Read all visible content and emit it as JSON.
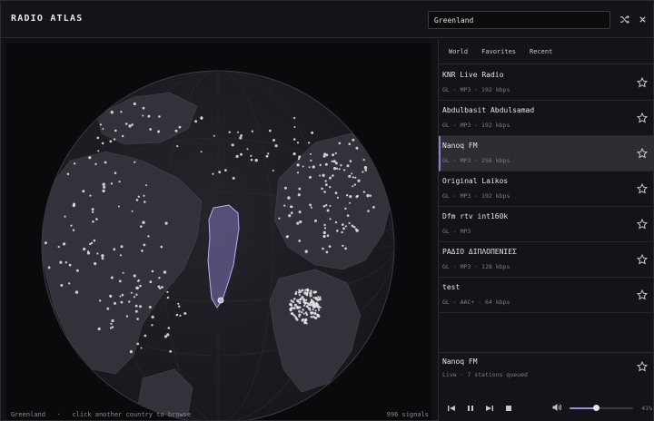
{
  "header": {
    "title": "RADIO ATLAS",
    "search_value": "Greenland",
    "shuffle_icon": "shuffle-icon",
    "close_icon": "close-icon"
  },
  "map": {
    "selected_country": "Greenland",
    "hint": "click another country to browse",
    "separator": "·",
    "signals": "996 signals",
    "colors": {
      "ocean": "#1c1c22",
      "land": "#33333b",
      "highlight": "#7c74b8",
      "marker": "#e8e8ee"
    }
  },
  "tabs": [
    "World",
    "Favorites",
    "Recent"
  ],
  "stations": [
    {
      "name": "KNR Live Radio",
      "meta": "GL · MP3 · 192 kbps",
      "active": false
    },
    {
      "name": "Abdulbasit Abdulsamad",
      "meta": "GL · MP3 · 192 kbps",
      "active": false
    },
    {
      "name": "Nanoq FM",
      "meta": "GL · MP3 · 256 kbps",
      "active": true
    },
    {
      "name": "Original Laikos",
      "meta": "GL · MP3 · 192 kbps",
      "active": false
    },
    {
      "name": "Dfm rtv int160k",
      "meta": "GL · MP3",
      "active": false
    },
    {
      "name": "ΡΑΔΙΟ ΔΙΠΛΟΠΕΝΙΕΣ",
      "meta": "GL · MP3 · 128 kbps",
      "active": false
    },
    {
      "name": "test",
      "meta": "GL · AAC+ · 64 kbps",
      "active": false
    }
  ],
  "now_playing": {
    "title": "Nanoq FM",
    "subtitle": "Live  ·  7 stations queued"
  },
  "controls": {
    "volume_value": 0.41,
    "volume_label": "41%"
  }
}
